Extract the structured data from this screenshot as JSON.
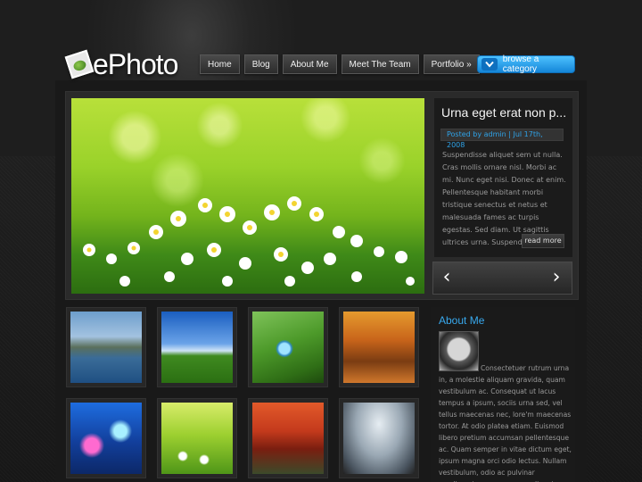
{
  "header": {
    "logo_text": "ePhoto",
    "nav": [
      "Home",
      "Blog",
      "About Me",
      "Meet The Team",
      "Portfolio »"
    ],
    "browse_label": "browse a category"
  },
  "featured": {
    "title": "Urna eget erat non p...",
    "meta": "Posted by admin | Jul 17th, 2008",
    "excerpt": "Suspendisse aliquet sem ut nulla. Cras mollis ornare nisl. Morbi ac mi. Nunc eget nisi. Donec at enim. Pellentesque habitant morbi tristique senectus et netus et malesuada fames ac turpis egestas. Sed diam. Ut sagittis ultrices urna. Suspendisse...",
    "read_more": "read more",
    "prev_arrow": "‹",
    "next_arrow": "›"
  },
  "about": {
    "title": "About Me",
    "text": "Consectetuer rutrum urna in, a molestie aliquam gravida, quam vestibulum ac. Consequat ut lacus tempus a ipsum, sociis urna sed, vel tellus maecenas nec, lore'm maecenas tortor. At odio platea etiam. Euismod libero pretium accumsan pellentesque ac. Quam semper in vitae dictum eget, ipsum magna orci odio lectus. Nullam vestibulum, odio ac pulvinar condimentum, urna neque aliquet ipsum, in"
  },
  "colors": {
    "accent": "#38a9ee",
    "browse_button": "#1d8fe0",
    "background": "#151515"
  }
}
